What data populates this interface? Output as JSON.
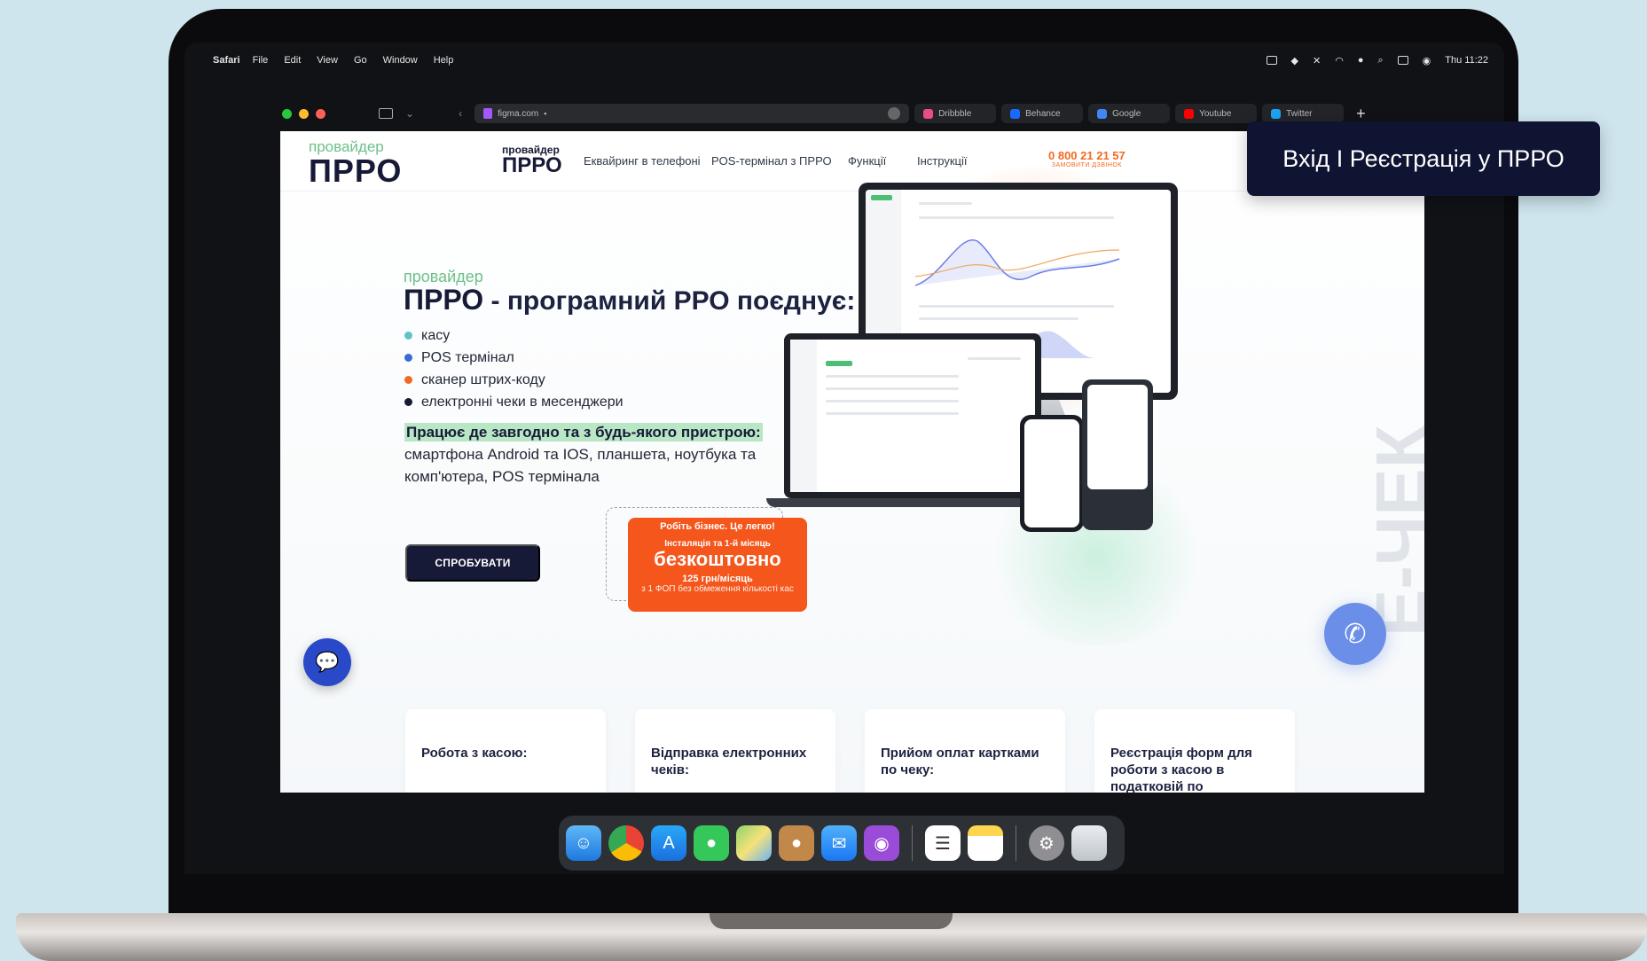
{
  "menubar": {
    "app_name": "Safari",
    "items": [
      "File",
      "Edit",
      "View",
      "Go",
      "Window",
      "Help"
    ],
    "clock": "Thu 11:22"
  },
  "browser": {
    "url": "figma.com",
    "favorites": [
      {
        "label": "Dribbble",
        "color": "#ea4c89"
      },
      {
        "label": "Behance",
        "color": "#1769ff"
      },
      {
        "label": "Google",
        "color": "#4285f4"
      },
      {
        "label": "Youtube",
        "color": "#ff0000"
      },
      {
        "label": "Twitter",
        "color": "#1da1f2"
      }
    ]
  },
  "site": {
    "logo": {
      "provider": "провайдер",
      "name": "ПРРО"
    },
    "nav_logo": {
      "provider": "провайдер",
      "name": "ПРРО"
    },
    "nav": [
      "Еквайринг в телефоні",
      "POS-термінал з ПРРО",
      "Функції",
      "Інструкції"
    ],
    "phone": {
      "number": "0 800 21 21 57",
      "callback": "ЗАМОВИТИ ДЗВІНОК"
    },
    "hero": {
      "provider": "провайдер",
      "brand": "ПРРО",
      "title_rest": " - програмний РРО поєднує:",
      "bullets": [
        {
          "text": "касу",
          "color": "#5ec3c8"
        },
        {
          "text": "POS термінал",
          "color": "#3d6bd6"
        },
        {
          "text": "сканер штрих-коду",
          "color": "#f26a22"
        },
        {
          "text": "електронні чеки в месенджери",
          "color": "#161a36"
        }
      ],
      "works_highlight": "Працює де завгодно та з будь-якого пристрою:",
      "works_text": "смартфона Android та IOS, планшета, ноутбука та комп'ютера, POS термінала",
      "try_button": "СПРОБУВАТИ"
    },
    "promo": {
      "line1": "Робіть бізнес. Це легко!",
      "line2": "Інсталяція та 1-й місяць",
      "line3": "безкоштовно",
      "line4": "125 грн/місяць",
      "line5": "з 1 ФОП без обмеження кількості кас"
    },
    "side_word": "Е-ЧЕК",
    "cards": [
      "Робота з касою:",
      "Відправка електронних чеків:",
      "Прийом оплат картками по чеку:",
      "Реєстрація форм для роботи з касою в податковій по"
    ]
  },
  "overlay": {
    "login": "Вхід І Реєстрація у ПРРО"
  }
}
